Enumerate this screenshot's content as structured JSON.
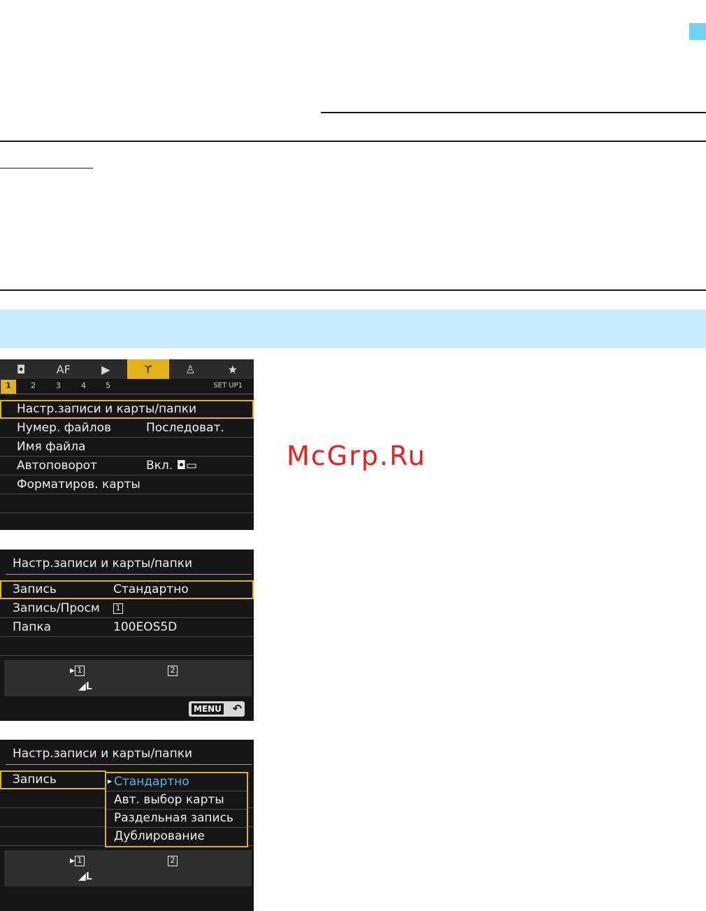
{
  "watermark": "McGrp.Ru",
  "accent_color": "#6fd3f7",
  "band_color": "#c8ecfb",
  "screen1": {
    "tabs": [
      {
        "name": "camera-icon",
        "glyph": "◘"
      },
      {
        "name": "af-tab",
        "glyph": "AF"
      },
      {
        "name": "play-icon",
        "glyph": "▶"
      },
      {
        "name": "wrench-icon",
        "glyph": "ϒ"
      },
      {
        "name": "custom-icon",
        "glyph": "♙"
      },
      {
        "name": "star-icon",
        "glyph": "★"
      }
    ],
    "subtabs": [
      "1",
      "2",
      "3",
      "4",
      "5"
    ],
    "set_label": "SET UP1",
    "rows": [
      {
        "label": "Настр.записи и карты/папки",
        "value": ""
      },
      {
        "label": "Нумер. файлов",
        "value": "Последоват."
      },
      {
        "label": "Имя файла",
        "value": ""
      },
      {
        "label": "Автоповорот",
        "value": "Вкл. ◘▭"
      },
      {
        "label": "Форматиров. карты",
        "value": ""
      }
    ]
  },
  "screen2": {
    "title": "Настр.записи и карты/папки",
    "rows": [
      {
        "label": "Запись",
        "value": "Стандартно"
      },
      {
        "label": "Запись/Просм",
        "value": "1"
      },
      {
        "label": "Папка",
        "value": "100EOS5D"
      }
    ],
    "card1": "1",
    "card2": "2",
    "quality": "◢L",
    "menu_label": "MENU",
    "back_glyph": "↶"
  },
  "screen3": {
    "title": "Настр.записи и карты/папки",
    "row_label": "Запись",
    "options": [
      "Стандартно",
      "Авт. выбор карты",
      "Раздельная запись",
      "Дублирование"
    ],
    "card1": "1",
    "card2": "2",
    "quality": "◢L"
  }
}
